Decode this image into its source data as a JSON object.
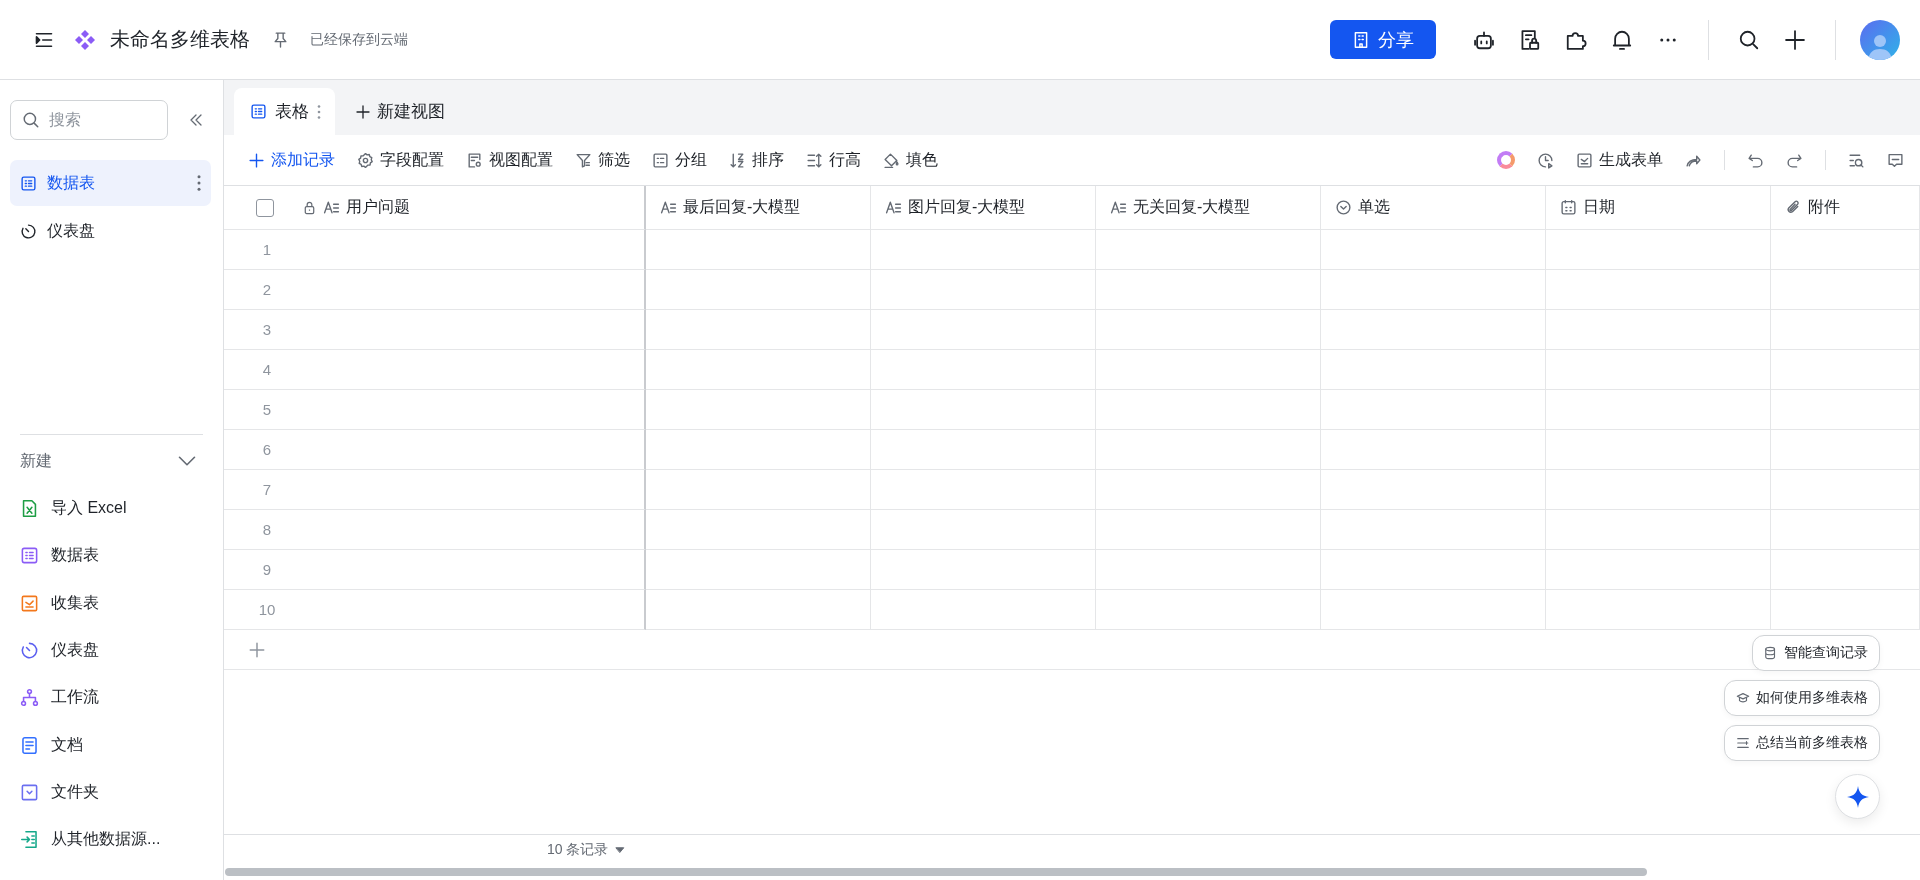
{
  "header": {
    "title": "未命名多维表格",
    "save_status": "已经保存到云端",
    "share_button": "分享"
  },
  "sidebar": {
    "search": {
      "placeholder": "搜索"
    },
    "items": [
      {
        "label": "数据表",
        "kind": "table",
        "selected": true
      },
      {
        "label": "仪表盘",
        "kind": "dashboard",
        "selected": false
      }
    ],
    "new_section": {
      "label": "新建",
      "expanded": true,
      "items": [
        {
          "label": "导入 Excel",
          "kind": "excel"
        },
        {
          "label": "数据表",
          "kind": "table"
        },
        {
          "label": "收集表",
          "kind": "form"
        },
        {
          "label": "仪表盘",
          "kind": "dashboard"
        },
        {
          "label": "工作流",
          "kind": "workflow"
        },
        {
          "label": "文档",
          "kind": "doc"
        },
        {
          "label": "文件夹",
          "kind": "folder"
        },
        {
          "label": "从其他数据源...",
          "kind": "import"
        }
      ]
    }
  },
  "tabs": [
    {
      "label": "表格",
      "selected": true
    }
  ],
  "new_view": "新建视图",
  "toolbar": {
    "left": [
      {
        "label": "添加记录",
        "kind": "add"
      },
      {
        "label": "字段配置",
        "kind": "field"
      },
      {
        "label": "视图配置",
        "kind": "view"
      },
      {
        "label": "筛选",
        "kind": "filter"
      },
      {
        "label": "分组",
        "kind": "group"
      },
      {
        "label": "排序",
        "kind": "sort"
      },
      {
        "label": "行高",
        "kind": "height"
      },
      {
        "label": "填色",
        "kind": "fill"
      }
    ],
    "right": [
      {
        "kind": "ai"
      },
      {
        "kind": "history"
      },
      {
        "kind": "form",
        "label": "生成表单"
      },
      {
        "kind": "share"
      },
      {
        "kind": "undo"
      },
      {
        "kind": "redo"
      },
      {
        "kind": "find"
      },
      {
        "kind": "comment"
      }
    ]
  },
  "table": {
    "select_all": {
      "checked": false
    },
    "columns": [
      {
        "label": "用户问题",
        "kind": "text",
        "locked": true
      },
      {
        "label": "最后回复-大模型",
        "kind": "text",
        "locked": false
      },
      {
        "label": "图片回复-大模型",
        "kind": "text",
        "locked": false
      },
      {
        "label": "无关回复-大模型",
        "kind": "text",
        "locked": false
      },
      {
        "label": "单选",
        "kind": "select",
        "locked": false
      },
      {
        "label": "日期",
        "kind": "date",
        "locked": false
      },
      {
        "label": "附件",
        "kind": "attachment",
        "locked": false
      }
    ],
    "rows": [
      "1",
      "2",
      "3",
      "4",
      "5",
      "6",
      "7",
      "8",
      "9",
      "10"
    ]
  },
  "assistant": {
    "suggestions": [
      {
        "label": "智能查询记录",
        "kind": "database"
      },
      {
        "label": "如何使用多维表格",
        "kind": "learn"
      },
      {
        "label": "总结当前多维表格",
        "kind": "summary"
      }
    ]
  },
  "footer": {
    "record_count": "10 条记录"
  }
}
